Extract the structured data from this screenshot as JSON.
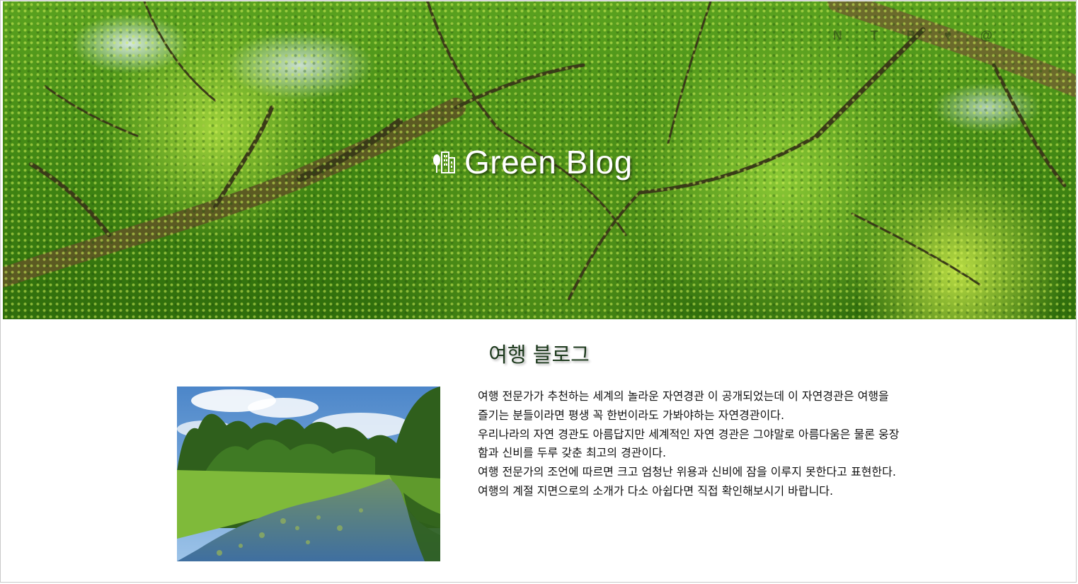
{
  "header": {
    "brand_title": "Green Blog",
    "logo_icon": "trees-city-icon",
    "top_icons": [
      "N",
      "T",
      "B",
      "♥",
      "@"
    ]
  },
  "main": {
    "section_title": "여행 블로그",
    "image_alt": "river-landscape",
    "paragraphs": [
      "여행 전문가가 추천하는 세계의 놀라운 자연경관 이 공개되었는데 이 자연경관은 여행을 즐기는 분들이라면 평생 꼭 한번이라도 가봐야하는 자연경관이다.",
      "우리나라의 자연 경관도 아름답지만 세계적인 자연 경관은 그야말로 아름다움은 물론 웅장함과 신비를 두루 갖춘 최고의 경관이다.",
      "여행 전문가의 조언에 따르면 크고 엄청난 위용과 신비에 잠을 이루지 못한다고 표현한다.",
      "여행의 계절 지면으로의 소개가 다소 아쉽다면 직접 확인해보시기 바랍니다."
    ]
  },
  "colors": {
    "title_dark_green": "#1d3a1d",
    "canopy_green": "#4a931a"
  }
}
